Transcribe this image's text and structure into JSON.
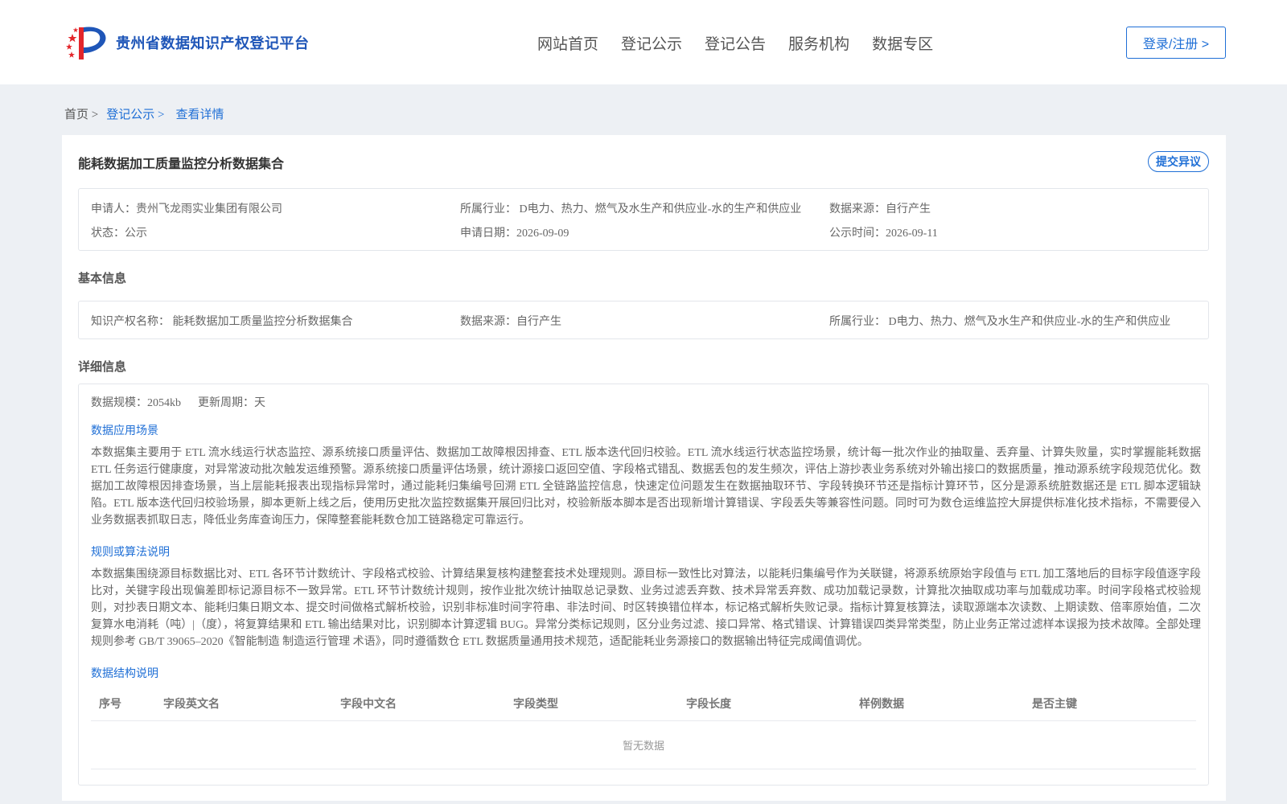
{
  "header": {
    "site_title": "贵州省数据知识产权登记平台",
    "nav": [
      "网站首页",
      "登记公示",
      "登记公告",
      "服务机构",
      "数据专区"
    ],
    "login_label": "登录/注册 >",
    "colors": {
      "brand": "#1f56b8",
      "accent": "#1f6fd6",
      "flag_red": "#e3262b"
    }
  },
  "breadcrumb": {
    "home": "首页 >",
    "section": "登记公示 >",
    "current": "查看详情"
  },
  "detail": {
    "title": "能耗数据加工质量监控分析数据集合",
    "objection_label": "提交异议",
    "meta": {
      "applicant": "申请人：贵州飞龙雨实业集团有限公司",
      "industry": "所属行业： D电力、热力、燃气及水生产和供应业-水的生产和供应业",
      "source": "数据来源：自行产生",
      "status": "状态：公示",
      "apply_date": "申请日期：2026-09-09",
      "publish_date": "公示时间：2026-09-11"
    },
    "basic": {
      "section_title": "基本信息",
      "ip_name": "知识产权名称： 能耗数据加工质量监控分析数据集合",
      "source": "数据来源：自行产生",
      "industry": "所属行业： D电力、热力、燃气及水生产和供应业-水的生产和供应业"
    },
    "info": {
      "section_title": "详细信息",
      "scale": "数据规模：2054kb",
      "cycle": "更新周期：天",
      "scenario_title": "数据应用场景",
      "scenario_text": "本数据集主要用于 ETL 流水线运行状态监控、源系统接口质量评估、数据加工故障根因排查、ETL 版本迭代回归校验。ETL 流水线运行状态监控场景，统计每一批次作业的抽取量、丢弃量、计算失败量，实时掌握能耗数据 ETL 任务运行健康度，对异常波动批次触发运维预警。源系统接口质量评估场景，统计源接口返回空值、字段格式错乱、数据丢包的发生频次，评估上游抄表业务系统对外输出接口的数据质量，推动源系统字段规范优化。数据加工故障根因排查场景，当上层能耗报表出现指标异常时，通过能耗归集编号回溯 ETL 全链路监控信息，快速定位问题发生在数据抽取环节、字段转换环节还是指标计算环节，区分是源系统脏数据还是 ETL 脚本逻辑缺陷。ETL 版本迭代回归校验场景，脚本更新上线之后，使用历史批次监控数据集开展回归比对，校验新版本脚本是否出现新增计算错误、字段丢失等兼容性问题。同时可为数仓运维监控大屏提供标准化技术指标，不需要侵入业务数据表抓取日志，降低业务库查询压力，保障整套能耗数仓加工链路稳定可靠运行。",
      "rules_title": "规则或算法说明",
      "rules_text": "本数据集围绕源目标数据比对、ETL 各环节计数统计、字段格式校验、计算结果复核构建整套技术处理规则。源目标一致性比对算法，以能耗归集编号作为关联键，将源系统原始字段值与 ETL 加工落地后的目标字段值逐字段比对，关键字段出现偏差即标记源目标不一致异常。ETL 环节计数统计规则，按作业批次统计抽取总记录数、业务过滤丢弃数、技术异常丢弃数、成功加载记录数，计算批次抽取成功率与加载成功率。时间字段格式校验规则，对抄表日期文本、能耗归集日期文本、提交时间做格式解析校验，识别非标准时间字符串、非法时间、时区转换错位样本，标记格式解析失败记录。指标计算复核算法，读取源端本次读数、上期读数、倍率原始值，二次复算水电消耗（吨）|（度），将复算结果和 ETL 输出结果对比，识别脚本计算逻辑 BUG。异常分类标记规则，区分业务过滤、接口异常、格式错误、计算错误四类异常类型，防止业务正常过滤样本误报为技术故障。全部处理规则参考 GB/T 39065‒2020《智能制造 制造运行管理 术语》，同时遵循数仓 ETL 数据质量通用技术规范，适配能耗业务源接口的数据输出特征完成阈值调优。",
      "structure_title": "数据结构说明",
      "columns": [
        "序号",
        "字段英文名",
        "字段中文名",
        "字段类型",
        "字段长度",
        "样例数据",
        "是否主键"
      ],
      "empty_text": "暂无数据"
    }
  }
}
